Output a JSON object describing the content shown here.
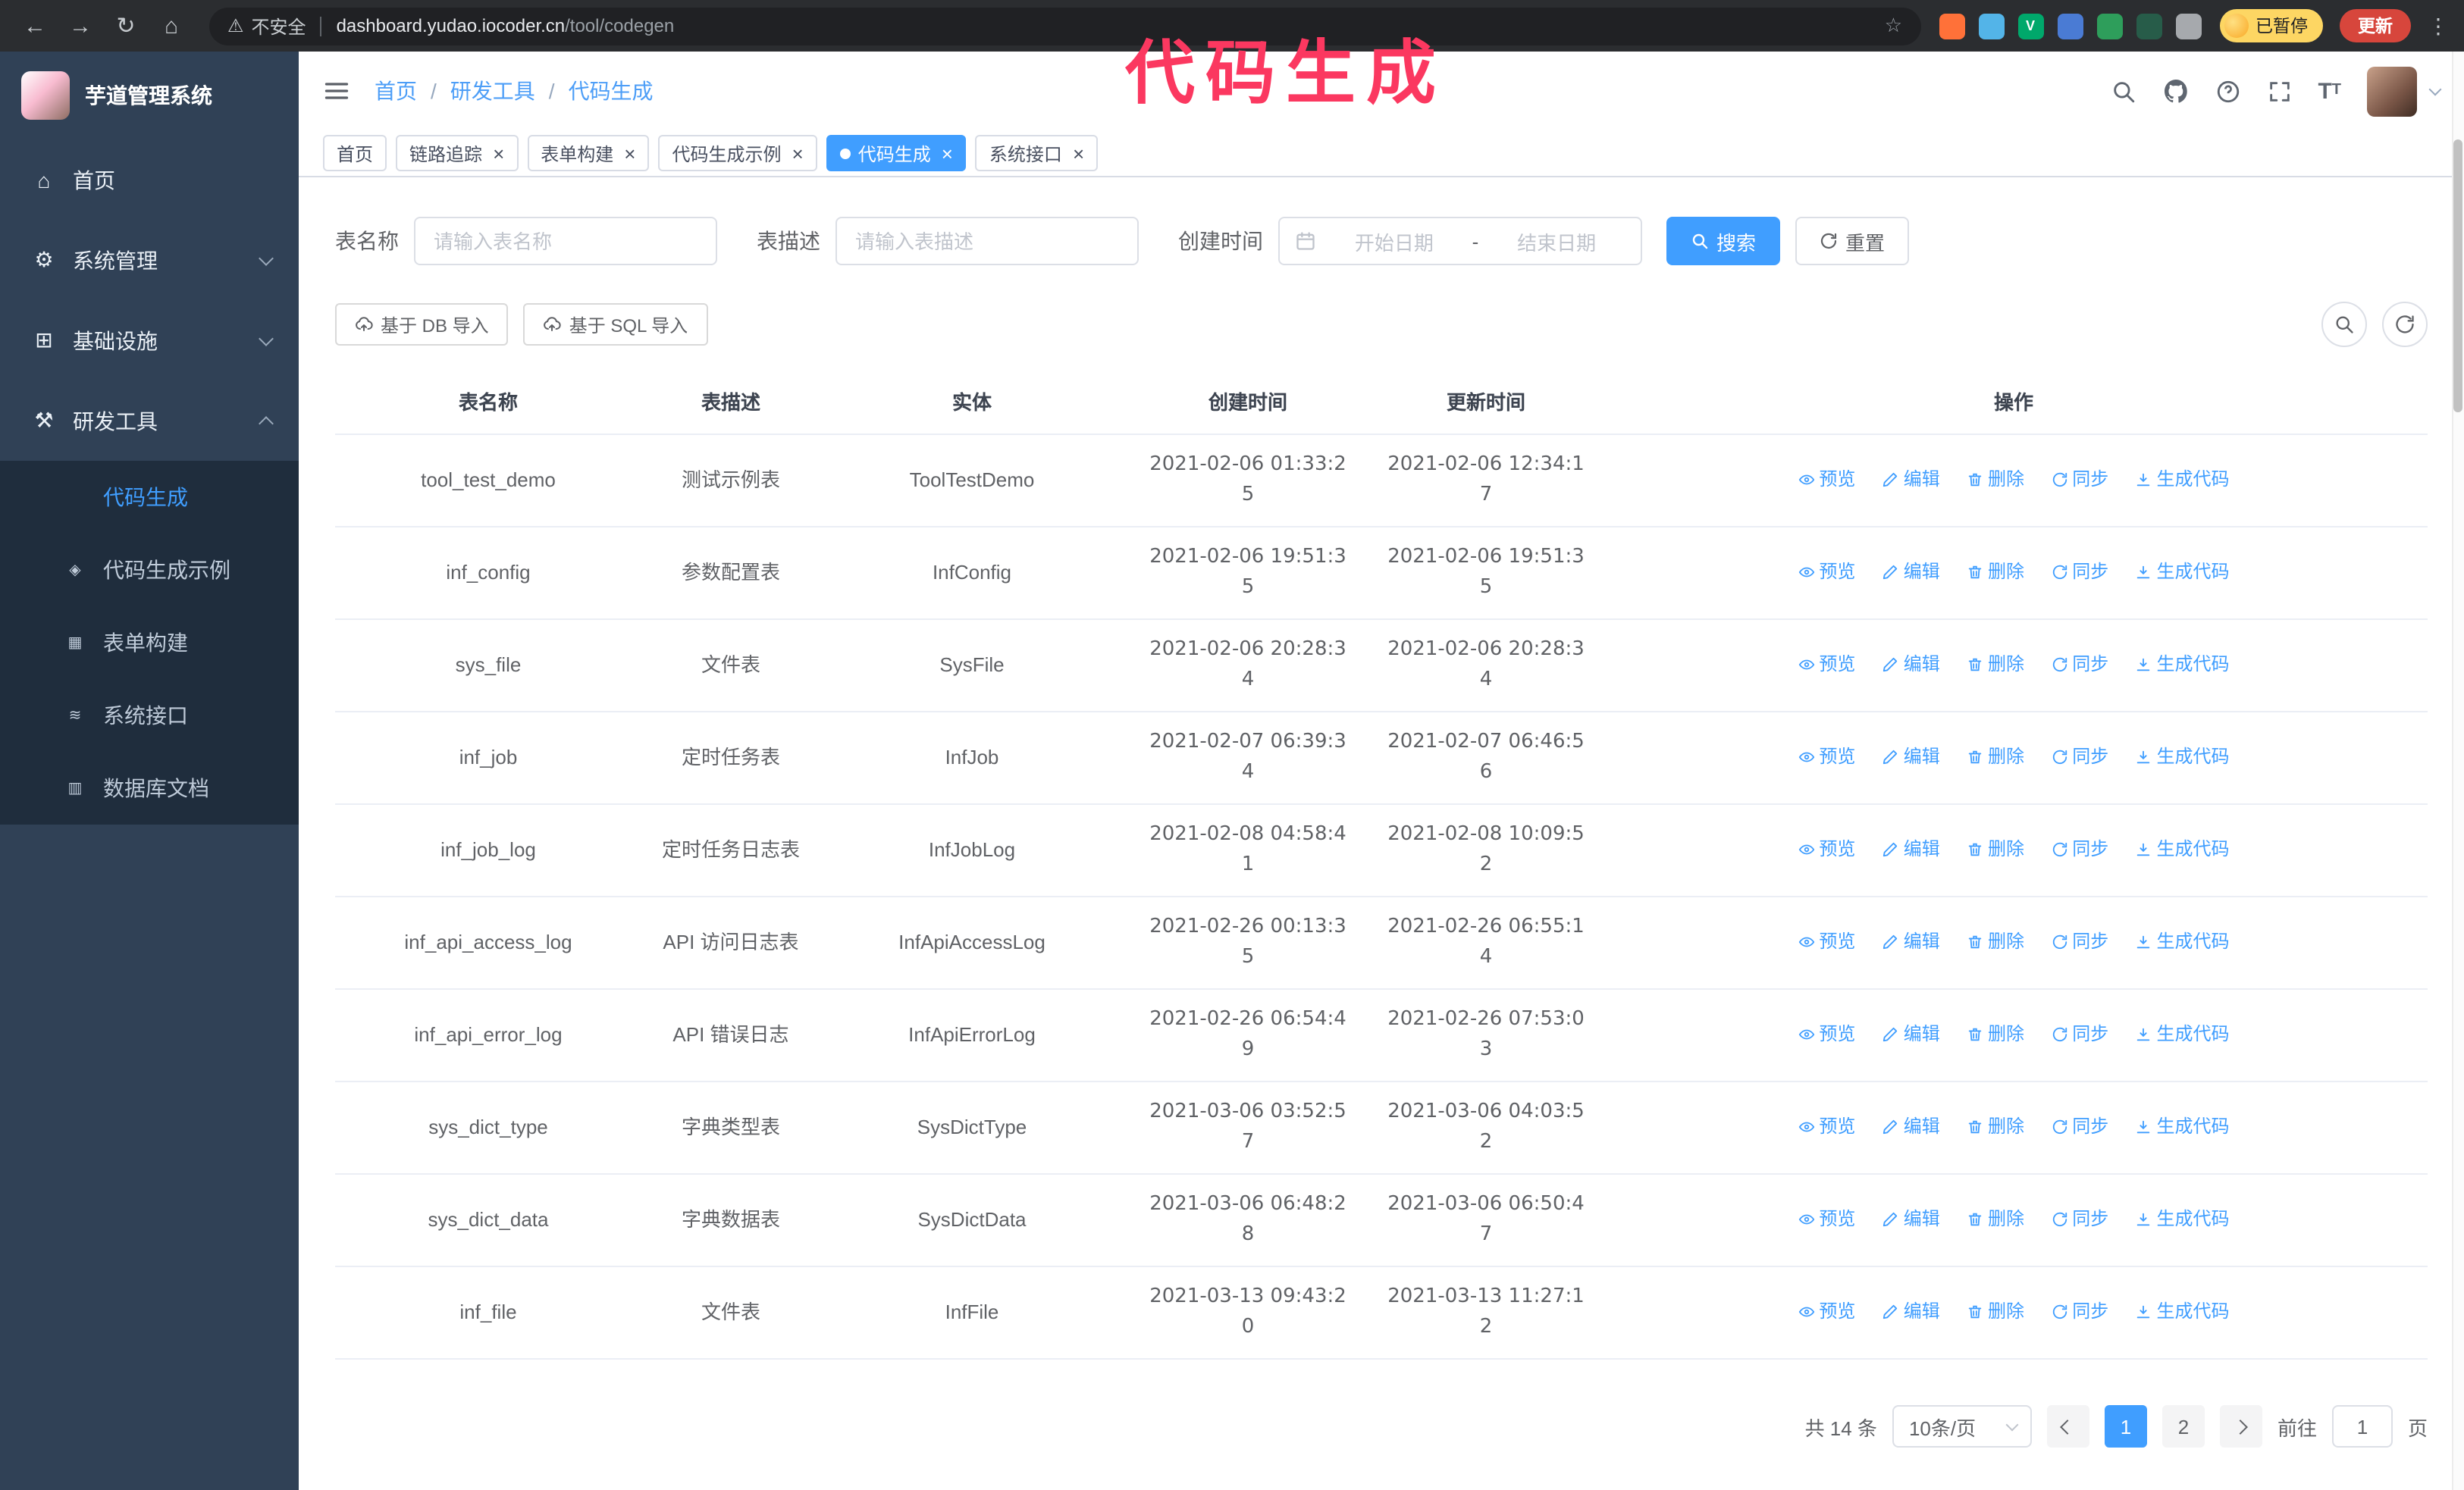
{
  "browser": {
    "security_warning": "不安全",
    "url_host": "dashboard.yudao.iocoder.cn",
    "url_path": "/tool/codegen",
    "paused_badge": "已暂停",
    "update_button": "更新",
    "extensions": [
      {
        "name": "fox-extension-icon",
        "color": "#ff7139",
        "letter": ""
      },
      {
        "name": "water-drop-extension-icon",
        "color": "#53b4e8",
        "letter": ""
      },
      {
        "name": "v-green-extension-icon",
        "color": "#00a86b",
        "letter": "V"
      },
      {
        "name": "people-extension-icon",
        "color": "#4a7bd4",
        "letter": ""
      },
      {
        "name": "card-extension-icon",
        "color": "#2e9e5b",
        "letter": ""
      },
      {
        "name": "leaf-extension-icon",
        "color": "#275c49",
        "letter": ""
      },
      {
        "name": "puzzle-extension-icon",
        "color": "#a6a9ad",
        "letter": ""
      }
    ]
  },
  "annotation": {
    "text": "代码生成",
    "color": "#fb3860"
  },
  "sidebar": {
    "logo_title": "芋道管理系统",
    "items": [
      {
        "label": "首页",
        "icon": "home-icon",
        "expandable": false,
        "expanded": false
      },
      {
        "label": "系统管理",
        "icon": "gear-icon",
        "expandable": true,
        "expanded": false
      },
      {
        "label": "基础设施",
        "icon": "infra-icon",
        "expandable": true,
        "expanded": false
      },
      {
        "label": "研发工具",
        "icon": "tools-icon",
        "expandable": true,
        "expanded": true
      }
    ],
    "subitems": [
      {
        "label": "代码生成",
        "icon": "code-icon",
        "active": true
      },
      {
        "label": "代码生成示例",
        "icon": "example-icon",
        "active": false
      },
      {
        "label": "表单构建",
        "icon": "form-icon",
        "active": false
      },
      {
        "label": "系统接口",
        "icon": "api-icon",
        "active": false
      },
      {
        "label": "数据库文档",
        "icon": "docs-icon",
        "active": false
      }
    ]
  },
  "icons": {
    "home-icon": "⌂",
    "gear-icon": "⚙",
    "infra-icon": "⊞",
    "tools-icon": "⚒",
    "code-icon": "</>",
    "example-icon": "◈",
    "form-icon": "▦",
    "api-icon": "≋",
    "docs-icon": "▥"
  },
  "header": {
    "breadcrumb": [
      "首页",
      "研发工具",
      "代码生成"
    ]
  },
  "tabs": [
    {
      "label": "首页",
      "closable": false,
      "active": false
    },
    {
      "label": "链路追踪",
      "closable": true,
      "active": false
    },
    {
      "label": "表单构建",
      "closable": true,
      "active": false
    },
    {
      "label": "代码生成示例",
      "closable": true,
      "active": false
    },
    {
      "label": "代码生成",
      "closable": true,
      "active": true
    },
    {
      "label": "系统接口",
      "closable": true,
      "active": false
    }
  ],
  "filters": {
    "table_name_label": "表名称",
    "table_name_placeholder": "请输入表名称",
    "table_desc_label": "表描述",
    "table_desc_placeholder": "请输入表描述",
    "create_time_label": "创建时间",
    "date_start_placeholder": "开始日期",
    "date_separator": "-",
    "date_end_placeholder": "结束日期",
    "search_button": "搜索",
    "reset_button": "重置"
  },
  "toolbar": {
    "import_db_label": "基于 DB 导入",
    "import_sql_label": "基于 SQL 导入"
  },
  "table": {
    "columns": [
      "表名称",
      "表描述",
      "实体",
      "创建时间",
      "更新时间",
      "操作"
    ],
    "actions": [
      "预览",
      "编辑",
      "删除",
      "同步",
      "生成代码"
    ],
    "rows": [
      {
        "name": "tool_test_demo",
        "desc": "测试示例表",
        "entity": "ToolTestDemo",
        "created": "2021-02-06 01:33:25",
        "updated": "2021-02-06 12:34:17"
      },
      {
        "name": "inf_config",
        "desc": "参数配置表",
        "entity": "InfConfig",
        "created": "2021-02-06 19:51:35",
        "updated": "2021-02-06 19:51:35"
      },
      {
        "name": "sys_file",
        "desc": "文件表",
        "entity": "SysFile",
        "created": "2021-02-06 20:28:34",
        "updated": "2021-02-06 20:28:34"
      },
      {
        "name": "inf_job",
        "desc": "定时任务表",
        "entity": "InfJob",
        "created": "2021-02-07 06:39:34",
        "updated": "2021-02-07 06:46:56"
      },
      {
        "name": "inf_job_log",
        "desc": "定时任务日志表",
        "entity": "InfJobLog",
        "created": "2021-02-08 04:58:41",
        "updated": "2021-02-08 10:09:52"
      },
      {
        "name": "inf_api_access_log",
        "desc": "API 访问日志表",
        "entity": "InfApiAccessLog",
        "created": "2021-02-26 00:13:35",
        "updated": "2021-02-26 06:55:14"
      },
      {
        "name": "inf_api_error_log",
        "desc": "API 错误日志",
        "entity": "InfApiErrorLog",
        "created": "2021-02-26 06:54:49",
        "updated": "2021-02-26 07:53:03"
      },
      {
        "name": "sys_dict_type",
        "desc": "字典类型表",
        "entity": "SysDictType",
        "created": "2021-03-06 03:52:57",
        "updated": "2021-03-06 04:03:52"
      },
      {
        "name": "sys_dict_data",
        "desc": "字典数据表",
        "entity": "SysDictData",
        "created": "2021-03-06 06:48:28",
        "updated": "2021-03-06 06:50:47"
      },
      {
        "name": "inf_file",
        "desc": "文件表",
        "entity": "InfFile",
        "created": "2021-03-13 09:43:20",
        "updated": "2021-03-13 11:27:12"
      }
    ]
  },
  "pagination": {
    "total": "共 14 条",
    "page_size": "10条/页",
    "pages": [
      "1",
      "2"
    ],
    "active": "1",
    "goto_label": "前往",
    "goto_value": "1",
    "goto_suffix": "页"
  },
  "colors": {
    "primary": "#409eff",
    "sidebar_bg": "#304156",
    "submenu_bg": "#1f2d3d",
    "chrome_bg": "#2b2d30",
    "annotation": "#fb3860",
    "paused_badge_bg": "#fdd663",
    "update_button_bg": "#d7463c"
  }
}
